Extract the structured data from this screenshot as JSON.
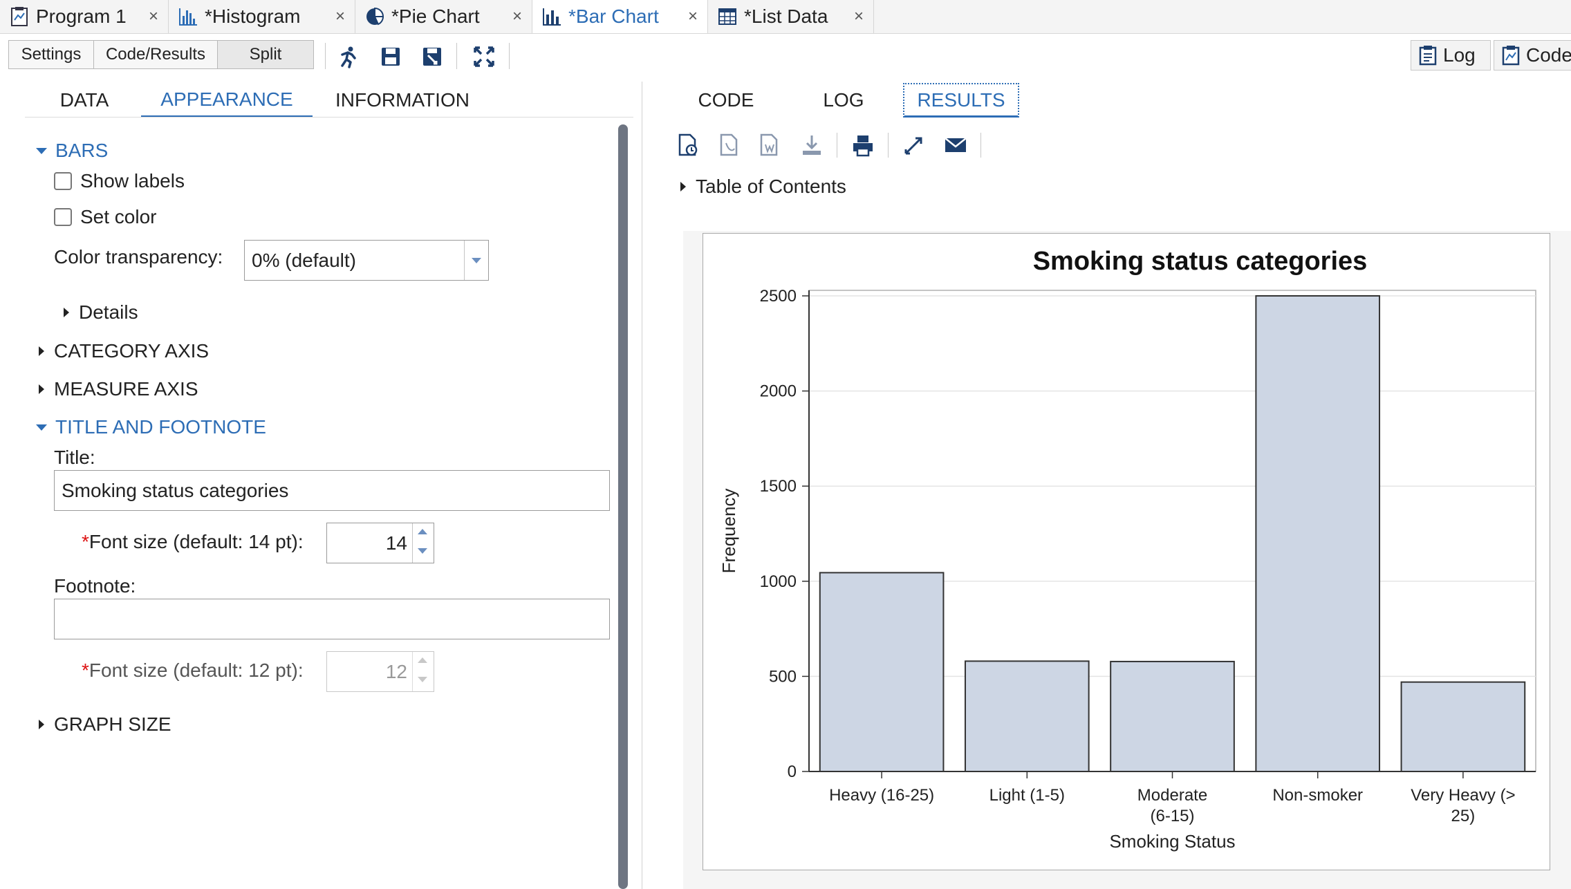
{
  "tabs": [
    {
      "label": "Program 1",
      "icon": "program-icon"
    },
    {
      "label": "*Histogram",
      "icon": "histogram-icon"
    },
    {
      "label": "*Pie Chart",
      "icon": "pie-chart-icon"
    },
    {
      "label": "*Bar Chart",
      "icon": "bar-chart-icon",
      "active": true
    },
    {
      "label": "*List Data",
      "icon": "table-icon"
    }
  ],
  "close_glyph": "×",
  "view_buttons": {
    "settings": "Settings",
    "code_results": "Code/Results",
    "split": "Split"
  },
  "right_buttons": {
    "log": "Log",
    "code": "Code"
  },
  "left_tabs": {
    "data": "DATA",
    "appearance": "APPEARANCE",
    "information": "INFORMATION"
  },
  "bars": {
    "section": "BARS",
    "show_labels": "Show labels",
    "set_color": "Set color",
    "transparency_label": "Color transparency:",
    "transparency_value": "0% (default)",
    "details": "Details"
  },
  "sections": {
    "category_axis": "CATEGORY AXIS",
    "measure_axis": "MEASURE AXIS",
    "title_footnote": "TITLE AND FOOTNOTE",
    "graph_size": "GRAPH SIZE"
  },
  "title_footnote": {
    "title_label": "Title:",
    "title_value": "Smoking status categories",
    "required_mark": "*",
    "title_font_label": "Font size (default: 14 pt):",
    "title_font_value": "14",
    "footnote_label": "Footnote:",
    "footnote_value": "",
    "footnote_font_label": "Font size (default: 12 pt):",
    "footnote_font_value": "12"
  },
  "right_tabs": {
    "code": "CODE",
    "log": "LOG",
    "results": "RESULTS"
  },
  "toc": "Table of Contents",
  "colors": {
    "accent": "#2d6db5",
    "bar_fill": "#cdd6e4",
    "bar_stroke": "#333333"
  },
  "chart_data": {
    "type": "bar",
    "title": "Smoking status categories",
    "xlabel": "Smoking Status",
    "ylabel": "Frequency",
    "categories": [
      [
        "Heavy (16-25)"
      ],
      [
        "Light (1-5)"
      ],
      [
        "Moderate",
        "(6-15)"
      ],
      [
        "Non-smoker"
      ],
      [
        "Very Heavy (>",
        "25)"
      ]
    ],
    "values": [
      1045,
      580,
      578,
      2500,
      470
    ],
    "ylim": [
      0,
      2500
    ],
    "yticks": [
      "0",
      "500",
      "1000",
      "1500",
      "2000",
      "2500"
    ],
    "grid": true
  }
}
